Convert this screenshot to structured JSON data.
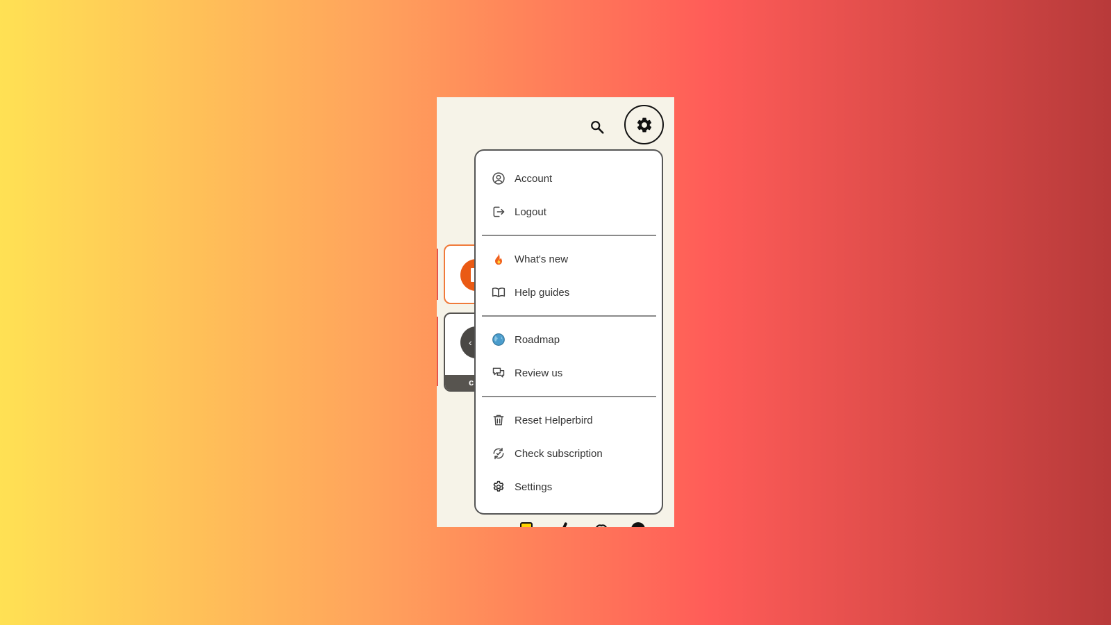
{
  "header": {
    "search_icon": "search-icon",
    "settings_icon": "gear-icon"
  },
  "menu": {
    "groups": [
      [
        {
          "label": "Account",
          "icon": "account-circle-icon"
        },
        {
          "label": "Logout",
          "icon": "logout-icon"
        }
      ],
      [
        {
          "label": "What's new",
          "icon": "fire-icon"
        },
        {
          "label": "Help guides",
          "icon": "book-icon"
        }
      ],
      [
        {
          "label": "Roadmap",
          "icon": "globe-icon"
        },
        {
          "label": "Review us",
          "icon": "chat-bubbles-icon"
        }
      ],
      [
        {
          "label": "Reset Helperbird",
          "icon": "trash-icon"
        },
        {
          "label": "Check subscription",
          "icon": "refresh-check-icon"
        },
        {
          "label": "Settings",
          "icon": "settings-cog-icon"
        }
      ]
    ]
  },
  "colors": {
    "accent_orange": "#ea5a14",
    "panel_background": "#f6f3e8"
  }
}
